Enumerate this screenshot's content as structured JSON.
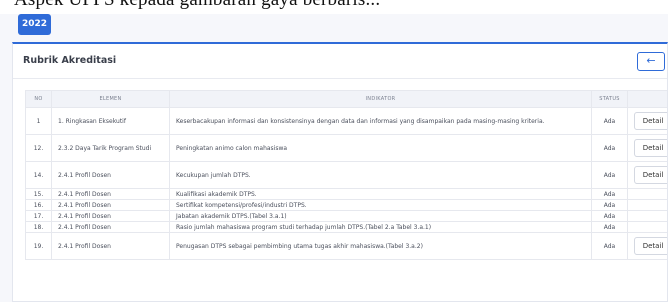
{
  "top_strip_text": "Aspek UPPS kepada gambaran gaya berbaris...",
  "year_tab": "2022",
  "card": {
    "title": "Rubrik Akreditasi",
    "back_label": "←"
  },
  "table": {
    "headers": [
      "NO",
      "ELEMEN",
      "INDIKATOR",
      "STATUS",
      ""
    ],
    "rows": [
      {
        "no": "1",
        "elemen": "1. Ringkasan Eksekutif",
        "indikator": "Keserbacakupan informasi dan konsistensinya dengan data dan informasi yang disampaikan pada masing-masing kriteria.",
        "status": "Ada",
        "aksi": "Detail"
      },
      {
        "no": "12.",
        "elemen": "2.3.2 Daya Tarik Program Studi",
        "indikator": "Peningkatan animo calon mahasiswa",
        "status": "Ada",
        "aksi": "Detail"
      },
      {
        "no": "14.",
        "elemen": "2.4.1 Profil Dosen",
        "indikator": "Kecukupan jumlah DTPS.",
        "status": "Ada",
        "aksi": "Detail"
      },
      {
        "no": "15.",
        "elemen": "2.4.1 Profil Dosen",
        "indikator": "Kualifikasi akademik DTPS.",
        "status": "Ada",
        "aksi": ""
      },
      {
        "no": "16.",
        "elemen": "2.4.1 Profil Dosen",
        "indikator": "Sertifikat kompetensi/profesi/industri DTPS.",
        "status": "Ada",
        "aksi": ""
      },
      {
        "no": "17.",
        "elemen": "2.4.1 Profil Dosen",
        "indikator": "Jabatan akademik DTPS.(Tabel 3.a.1)",
        "status": "Ada",
        "aksi": ""
      },
      {
        "no": "18.",
        "elemen": "2.4.1 Profil Dosen",
        "indikator": "Rasio jumlah mahasiswa program studi terhadap jumlah DTPS.(Tabel 2.a Tabel 3.a.1)",
        "status": "Ada",
        "aksi": ""
      },
      {
        "no": "19.",
        "elemen": "2.4.1 Profil Dosen",
        "indikator": "Penugasan DTPS sebagai pembimbing utama tugas akhir mahasiswa.(Tabel 3.a.2)",
        "status": "Ada",
        "aksi": "Detail"
      }
    ]
  }
}
